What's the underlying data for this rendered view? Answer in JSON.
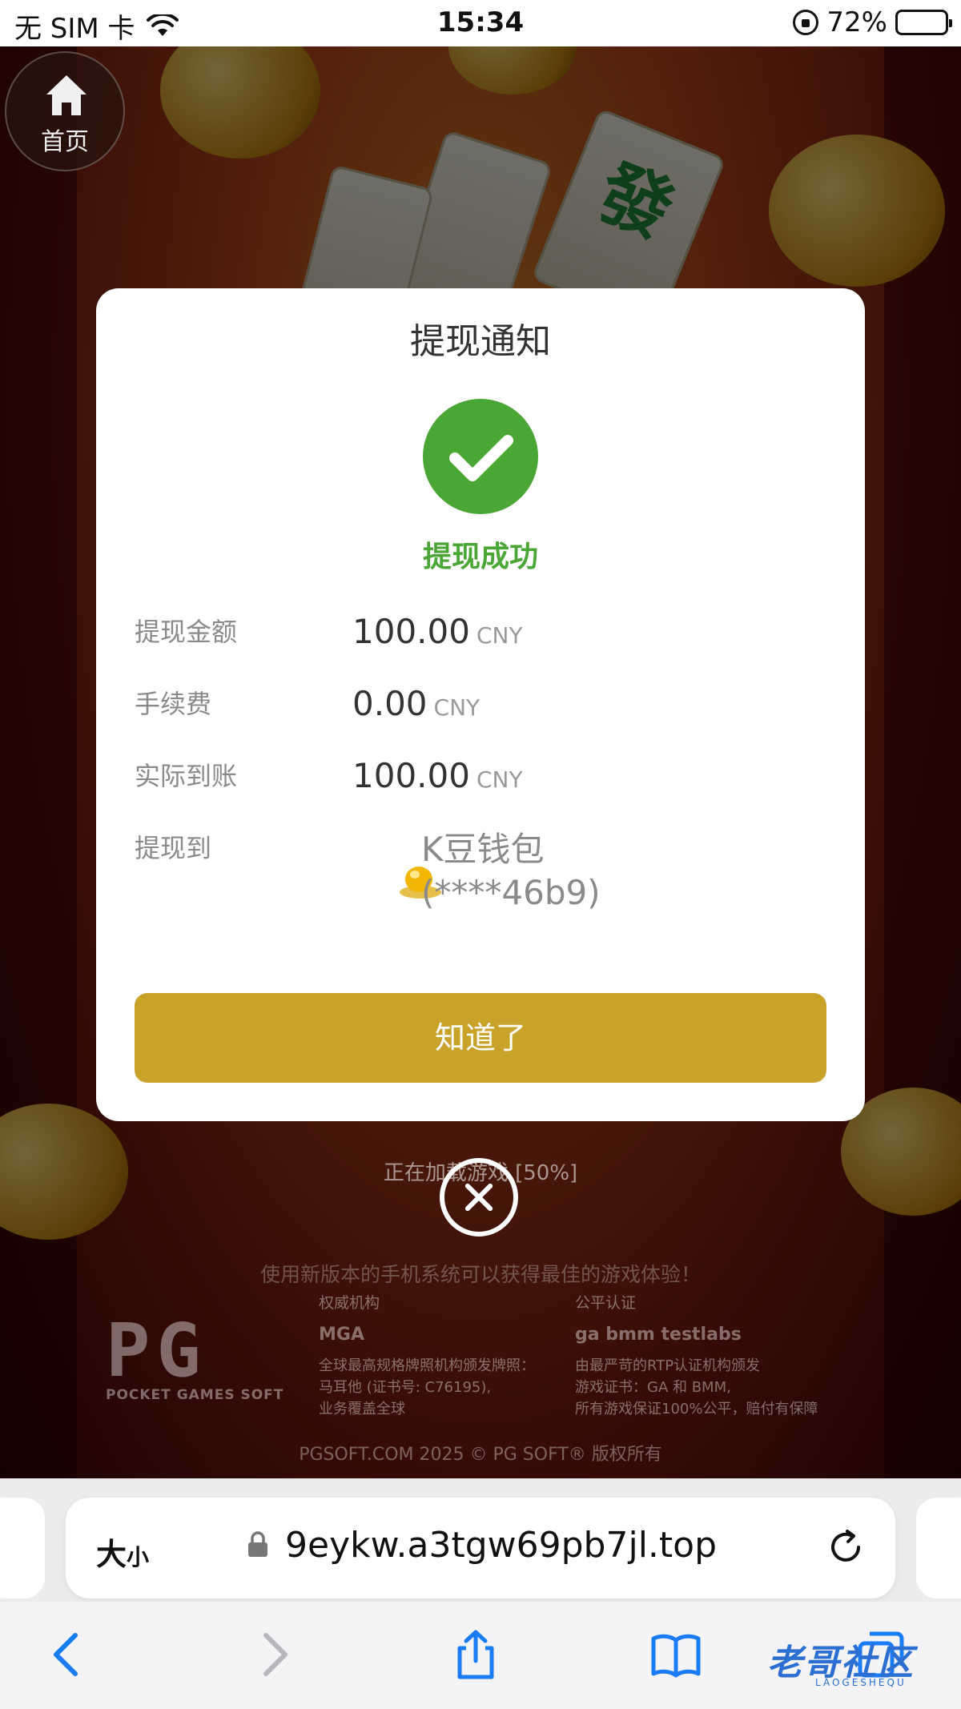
{
  "status_bar": {
    "carrier": "无 SIM 卡",
    "time": "15:34",
    "battery": "72%"
  },
  "game": {
    "home_label": "首页",
    "loading_text": "正在加载游戏 [50%]",
    "loading_progress": 0.5,
    "tip": "使用新版本的手机系统可以获得最佳的游戏体验！",
    "brand_big": "PG",
    "brand_small": "POCKET GAMES SOFT",
    "authority": {
      "title": "权威机构",
      "logo": "MGA",
      "lines": [
        "全球最高规格牌照机构颁发牌照：",
        "马耳他 (证书号: C76195),",
        "业务覆盖全球"
      ]
    },
    "fair": {
      "title": "公平认证",
      "logos": "ga  bmm testlabs",
      "lines": [
        "由最严苛的RTP认证机构颁发",
        "游戏证书：GA 和 BMM,",
        "所有游戏保证100%公平，赔付有保障"
      ]
    },
    "copyright": "PGSOFT.COM 2025 © PG SOFT® 版权所有"
  },
  "modal": {
    "title": "提现通知",
    "status": "提现成功",
    "rows": [
      {
        "label": "提现金额",
        "value": "100.00",
        "unit": "CNY"
      },
      {
        "label": "手续费",
        "value": "0.00",
        "unit": "CNY"
      },
      {
        "label": "实际到账",
        "value": "100.00",
        "unit": "CNY"
      }
    ],
    "dest_label": "提现到",
    "dest_name": "K豆钱包",
    "dest_account": "(****46b9)",
    "confirm_label": "知道了"
  },
  "browser": {
    "text_size_big": "大",
    "text_size_small": "小",
    "url": "9eykw.a3tgw69pb7jl.top"
  },
  "watermark": {
    "text": "老哥社区",
    "sub": "LAOGESHEQU"
  },
  "colors": {
    "accent_gold": "#c9a229",
    "success_green": "#4aa635"
  }
}
